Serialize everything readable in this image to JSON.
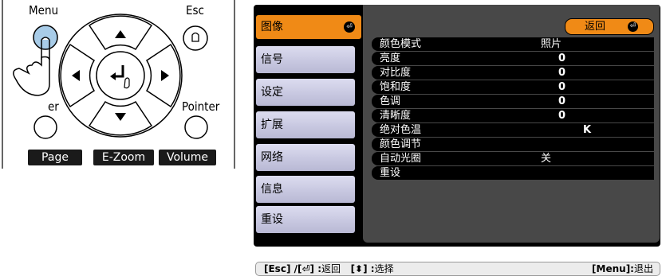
{
  "remote": {
    "menu_label": "Menu",
    "esc_label": "Esc",
    "pointer_label": "Pointer",
    "partial_label": "er",
    "page_key": "Page",
    "ezoom_key": "E-Zoom",
    "volume_key": "Volume"
  },
  "sidebar": {
    "items": [
      {
        "label": "图像",
        "active": true
      },
      {
        "label": "信号"
      },
      {
        "label": "设定"
      },
      {
        "label": "扩展"
      },
      {
        "label": "网络"
      },
      {
        "label": "信息"
      },
      {
        "label": "重设"
      }
    ]
  },
  "back_button": {
    "label": "返回"
  },
  "settings": [
    {
      "name": "颜色模式",
      "value": "照片"
    },
    {
      "name": "亮度",
      "value": "0"
    },
    {
      "name": "对比度",
      "value": "0"
    },
    {
      "name": "饱和度",
      "value": "0"
    },
    {
      "name": "色调",
      "value": "0"
    },
    {
      "name": "清晰度",
      "value": "0"
    },
    {
      "name": "绝对色温",
      "value": "K"
    },
    {
      "name": "颜色调节",
      "value": ""
    },
    {
      "name": "自动光圈",
      "value": "关"
    },
    {
      "name": "重设",
      "value": ""
    }
  ],
  "help": {
    "left_keys": "[Esc] /[",
    "left_mid": "] :",
    "back_text": "返回",
    "select_keys": "[",
    "select_mid": "] :",
    "select_text": "选择",
    "exit_key": "[Menu]:",
    "exit_text": "退出"
  },
  "colors": {
    "accent": "#f08a16",
    "panel": "#484848",
    "tab": "#c8c8e0"
  }
}
